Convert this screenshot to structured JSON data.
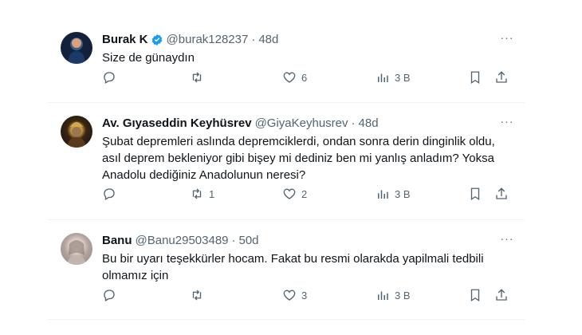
{
  "tweets": [
    {
      "name": "Burak K",
      "verified": true,
      "handle": "@burak128237",
      "sep": "·",
      "time": "48d",
      "text": "Size de günaydın",
      "replies": "",
      "retweets": "",
      "likes": "6",
      "views": "3 B",
      "avatar_icon": "avatar-man-photo"
    },
    {
      "name": "Av. Gıyaseddin Keyhüsrev",
      "verified": false,
      "handle": "@GiyaKeyhusrev",
      "sep": "·",
      "time": "48d",
      "text": "Şubat depremleri aslında depremciklerdi, ondan sonra derin dinginlik oldu,\nasıl deprem bekleniyor gibi bişey mi dediniz ben mi yanlış anladım? Yoksa\nAnadolu dediğiniz Anadolunun neresi?",
      "replies": "",
      "retweets": "1",
      "likes": "2",
      "views": "3 B",
      "avatar_icon": "avatar-sultan-portrait"
    },
    {
      "name": "Banu",
      "verified": false,
      "handle": "@Banu29503489",
      "sep": "·",
      "time": "50d",
      "text": "Bu bir uyarı teşekkürler hocam. Fakat bu resmi olarakda  yapilmali  tedbili\nolmamız için",
      "replies": "",
      "retweets": "",
      "likes": "3",
      "views": "3 B",
      "avatar_icon": "avatar-woman-photo"
    }
  ],
  "more_icon": "···",
  "colors": {
    "text": "#0f1419",
    "secondary": "#536471",
    "verified": "#1d9bf0",
    "divider": "#eff3f4"
  }
}
